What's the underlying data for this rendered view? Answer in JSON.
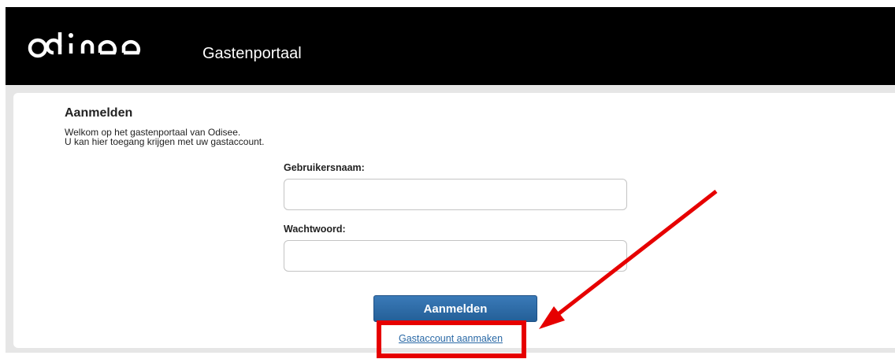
{
  "header": {
    "logo_text": "odisee",
    "title": "Gastenportaal"
  },
  "login": {
    "title": "Aanmelden",
    "welcome_line1": "Welkom op het gastenportaal van Odisee.",
    "welcome_line2": "U kan hier toegang krijgen met uw gastaccount.",
    "username_label": "Gebruikersnaam:",
    "username_value": "",
    "password_label": "Wachtwoord:",
    "password_value": "",
    "submit_label": "Aanmelden",
    "create_account_link": "Gastaccount aanmaken"
  },
  "annotation": {
    "color": "#e60000"
  }
}
